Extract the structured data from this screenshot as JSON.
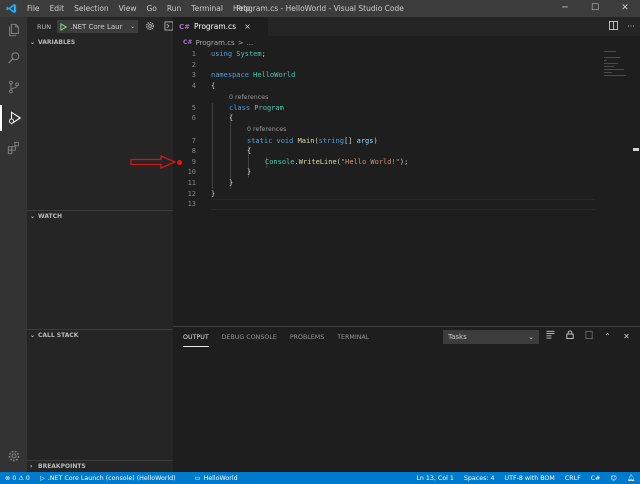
{
  "window": {
    "title": "Program.cs - HelloWorld - Visual Studio Code",
    "menu": [
      "File",
      "Edit",
      "Selection",
      "View",
      "Go",
      "Run",
      "Terminal",
      "Help"
    ],
    "controls": {
      "minimize": "─",
      "maximize": "☐",
      "close": "✕"
    }
  },
  "sidebar": {
    "run_label": "RUN",
    "launch_config": ".NET Core Laur",
    "sections": {
      "variables": "VARIABLES",
      "watch": "WATCH",
      "call_stack": "CALL STACK",
      "breakpoints": "BREAKPOINTS"
    }
  },
  "editor": {
    "tab_name": "Program.cs",
    "tab_close": "×",
    "breadcrumb_file": "Program.cs",
    "breadcrumb_sep": ">",
    "breadcrumb_more": "...",
    "line_numbers": [
      "1",
      "2",
      "3",
      "4",
      "5",
      "6",
      "7",
      "8",
      "9",
      "10",
      "11",
      "12",
      "13"
    ],
    "code": {
      "l1_kw": "using",
      "l1_ns": "System",
      "l1_end": ";",
      "l3_kw": "namespace",
      "l3_name": "HelloWorld",
      "l4": "{",
      "l5_kw": "class",
      "l5_name": "Program",
      "l6": "{",
      "l7_kw": "static void",
      "l7_fn": "Main",
      "l7_open": "(",
      "l7_type": "string",
      "l7_brackets": "[] ",
      "l7_param": "args",
      "l7_close": ")",
      "l8": "{",
      "l9_type": "Console",
      "l9_dot": ".",
      "l9_fn": "WriteLine",
      "l9_open": "(",
      "l9_str": "\"Hello World!\"",
      "l9_close": ");",
      "l10": "}",
      "l11": "}",
      "l12": "}"
    },
    "codelens_class": "0 references",
    "codelens_method": "0 references",
    "breakpoint_line": 9
  },
  "panel": {
    "tabs": [
      "OUTPUT",
      "DEBUG CONSOLE",
      "PROBLEMS",
      "TERMINAL"
    ],
    "task_select": "Tasks"
  },
  "statusbar": {
    "problems": "⊗ 0  ⚠ 0",
    "launch": ".NET Core Launch (console) (HelloWorld)",
    "project": "HelloWorld",
    "position": "Ln 13, Col 1",
    "spaces": "Spaces: 4",
    "encoding": "UTF-8 with BOM",
    "eol": "CRLF",
    "language": "C#"
  },
  "colors": {
    "accent": "#007acc",
    "breakpoint": "#e51400",
    "annotation_arrow": "#d01818"
  }
}
